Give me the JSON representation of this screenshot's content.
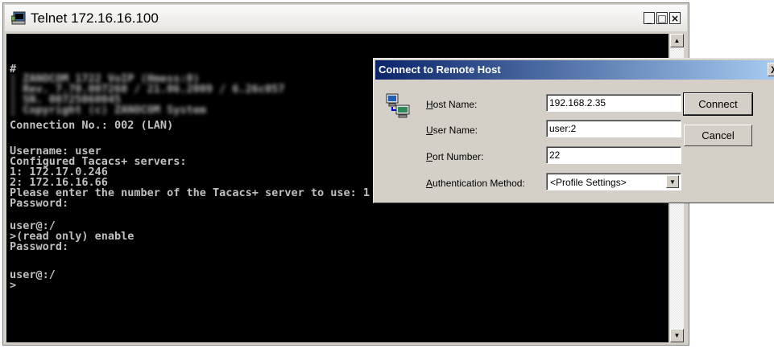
{
  "telnet": {
    "title": "Telnet 172.16.16.100",
    "controls": {
      "minimize": "_",
      "maximize": "□",
      "close": "×"
    }
  },
  "terminal": {
    "lines": [
      "#",
      "¦ ZANOCOM 1722 VoIP (Hmess:0)",
      "¦ Rev. 7.70.007260 / 21.06.2009 / 6.26c057",
      "¦ SN. 00725060045",
      "¦ Copyright (c) ZANOCOM System",
      "Connection No.: 002 (LAN)",
      "",
      "Username: user",
      "Configured Tacacs+ servers:",
      "1: 172.17.0.246",
      "2: 172.16.16.66",
      "Please enter the number of the Tacacs+ server to use: 1",
      "Password:",
      "",
      "user@:/",
      ">(read only) enable",
      "Password:",
      "",
      "user@:/",
      ">"
    ]
  },
  "dialog": {
    "title": "Connect to Remote Host",
    "close": "X",
    "host_name": {
      "label_key": "H",
      "label_rest": "ost Name:",
      "value": "192.168.2.35"
    },
    "user_name": {
      "label_key": "U",
      "label_rest": "ser Name:",
      "value": "user:2"
    },
    "port_number": {
      "label_key": "P",
      "label_rest": "ort Number:",
      "value": "22"
    },
    "auth_method": {
      "label_key": "A",
      "label_rest": "uthentication Method:",
      "value": "<Profile Settings>"
    },
    "connect_label": "Connect",
    "cancel_label": "Cancel"
  }
}
